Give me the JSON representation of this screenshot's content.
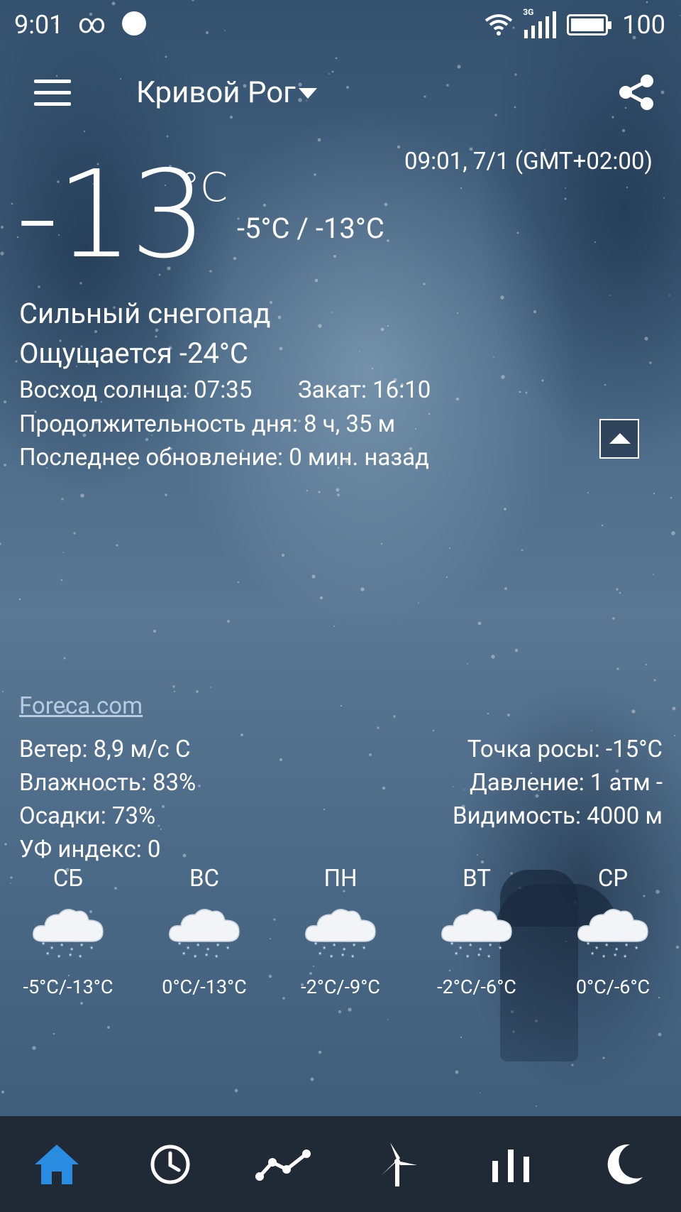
{
  "status_bar": {
    "time": "9:01",
    "infinity_glyph": "∞",
    "network": "3G",
    "battery": "100"
  },
  "header": {
    "city": "Кривой Рог"
  },
  "current": {
    "datetime": "09:01, 7/1 (GMT+02:00)",
    "temp_sign": "-",
    "temp_value": "13",
    "temp_unit": "°C",
    "hi_lo": "-5°C / -13°C",
    "condition": "Сильный снегопад",
    "feels_like": "Ощущается -24°C",
    "sunrise": "Восход солнца:  07:35",
    "sunset": "Закат:  16:10",
    "day_length": "Продолжительность дня: 8 ч, 35 м",
    "last_update": "Последнее обновление: 0 мин. назад"
  },
  "source_link": "Foreca.com",
  "details": {
    "left": [
      "Ветер:  8,9 м/с С",
      "Влажность:  83%",
      "Осадки:  73%",
      "УФ индекс:  0"
    ],
    "right": [
      "Точка росы:  -15°C",
      "Давление:  1 атм -",
      "Видимость:  4000 м"
    ]
  },
  "forecast": [
    {
      "day": "СБ",
      "range": "-5°C/-13°C",
      "icon": "heavy-snow-cloud-icon"
    },
    {
      "day": "ВС",
      "range": "0°C/-13°C",
      "icon": "heavy-snow-cloud-icon"
    },
    {
      "day": "ПН",
      "range": "-2°C/-9°C",
      "icon": "heavy-snow-cloud-icon"
    },
    {
      "day": "ВТ",
      "range": "-2°C/-6°C",
      "icon": "heavy-snow-cloud-icon"
    },
    {
      "day": "СР",
      "range": "0°C/-6°C",
      "icon": "heavy-snow-cloud-icon"
    }
  ],
  "nav": [
    {
      "icon": "home-icon",
      "active": true,
      "color": "#2a8ce0"
    },
    {
      "icon": "clock-icon",
      "active": false,
      "color": "#ffffff"
    },
    {
      "icon": "trend-chart-icon",
      "active": false,
      "color": "#ffffff"
    },
    {
      "icon": "wind-turbine-icon",
      "active": false,
      "color": "#ffffff"
    },
    {
      "icon": "bar-chart-icon",
      "active": false,
      "color": "#ffffff"
    },
    {
      "icon": "moon-icon",
      "active": false,
      "color": "#ffffff"
    }
  ]
}
